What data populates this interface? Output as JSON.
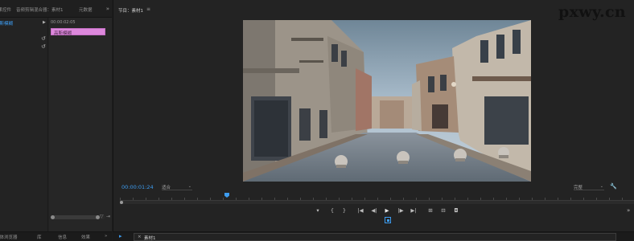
{
  "left_panel": {
    "tabs": [
      "效果控件",
      "音频剪辑混合器：素材1",
      "元数据"
    ],
    "effect_item": "高斯模糊",
    "timecode": "00:00:02:05",
    "clip_label": "高斯模糊"
  },
  "bottom_left_tabs": [
    "媒体浏览器",
    "库",
    "信息",
    "效果"
  ],
  "program": {
    "tab_label": "节目：素材1",
    "timecode": "00:00:01:24",
    "fit": "适合",
    "quality": "完整"
  },
  "timeline": {
    "tab_label": "素材1"
  },
  "watermark": "pxwy.cn",
  "icons": {
    "panel_menu": "menu-icon",
    "more": "chevron-double-right-icon",
    "settings": "wrench-icon"
  },
  "colors": {
    "accent": "#3d9cf0",
    "clip": "#dd88dc"
  }
}
